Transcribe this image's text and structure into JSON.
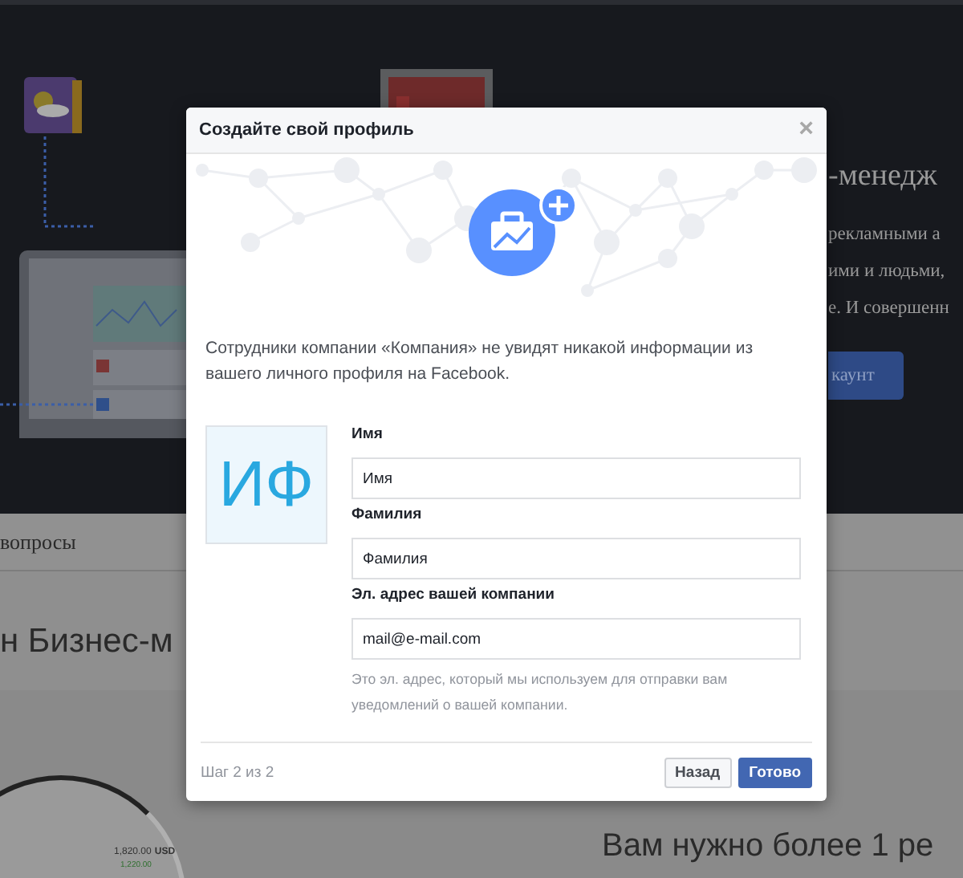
{
  "background": {
    "heading": "-менедж",
    "paragraph_lines": [
      "рекламными а",
      "ими и людьми,",
      "е. И совершенн"
    ],
    "button": "каунт",
    "nav_item": "вопросы",
    "section_heading": "н Бизнес-м",
    "amount": "1,820.00",
    "currency": "USD",
    "amount_2": "1,220.00",
    "lower_heading": "Вам нужно более 1 ре"
  },
  "dialog": {
    "title": "Создайте свой профиль",
    "close": "×",
    "description": "Сотрудники компании «Компания» не увидят никакой информации из вашего личного профиля на Facebook.",
    "avatar_initials": "ИФ",
    "fields": [
      {
        "label": "Имя",
        "value": "Имя"
      },
      {
        "label": "Фамилия",
        "value": "Фамилия"
      },
      {
        "label": "Эл. адрес вашей компании",
        "value": "mail@e-mail.com"
      }
    ],
    "hint": "Это эл. адрес, который мы используем для отправки вам уведомлений о вашей компании.",
    "step": "Шаг 2 из 2",
    "buttons": [
      {
        "label": "Назад",
        "kind": "secondary"
      },
      {
        "label": "Готово",
        "kind": "primary"
      }
    ]
  }
}
